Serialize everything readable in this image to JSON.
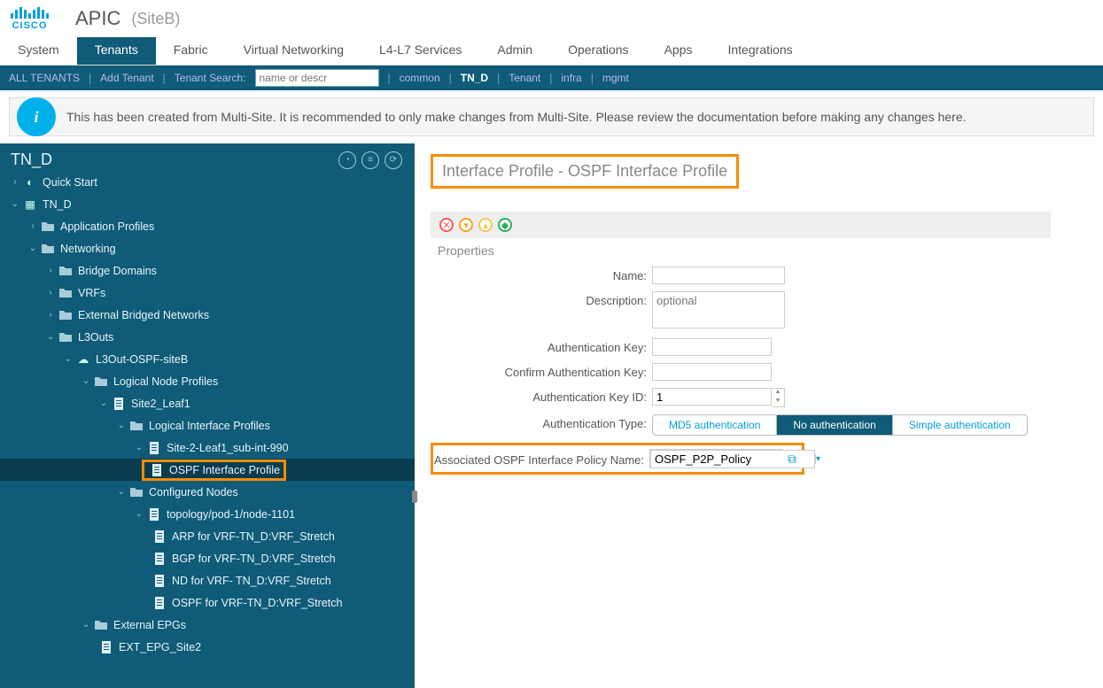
{
  "header": {
    "brand": "CISCO",
    "app": "APIC",
    "site": "(SiteB)"
  },
  "nav": {
    "items": [
      "System",
      "Tenants",
      "Fabric",
      "Virtual Networking",
      "L4-L7 Services",
      "Admin",
      "Operations",
      "Apps",
      "Integrations"
    ],
    "active_index": 1
  },
  "subnav": {
    "all_tenants": "ALL TENANTS",
    "add_tenant": "Add Tenant",
    "search_label": "Tenant Search:",
    "search_placeholder": "name or descr",
    "links": [
      "common",
      "TN_D",
      "Tenant",
      "infra",
      "mgmt"
    ],
    "bold_index": 1
  },
  "banner": {
    "message": "This has been created from Multi-Site. It is recommended to only make changes from Multi-Site. Please review the documentation before making any changes here."
  },
  "sidebar": {
    "title": "TN_D",
    "quick_start": "Quick Start",
    "tenant": "TN_D",
    "app_profiles": "Application Profiles",
    "networking": "Networking",
    "bridge_domains": "Bridge Domains",
    "vrfs": "VRFs",
    "ext_bridged": "External Bridged Networks",
    "l3outs": "L3Outs",
    "l3out_ospf": "L3Out-OSPF-siteB",
    "lnp": "Logical Node Profiles",
    "site2leaf1": "Site2_Leaf1",
    "lip": "Logical Interface Profiles",
    "subint": "Site-2-Leaf1_sub-int-990",
    "ospf_ip": "OSPF Interface Profile",
    "conf_nodes": "Configured Nodes",
    "topo_node": "topology/pod-1/node-1101",
    "arp": "ARP for VRF-TN_D:VRF_Stretch",
    "bgp": "BGP for VRF-TN_D:VRF_Stretch",
    "nd": "ND for VRF- TN_D:VRF_Stretch",
    "ospf": "OSPF for VRF-TN_D:VRF_Stretch",
    "ext_epgs": "External EPGs",
    "ext_epg_item": "EXT_EPG_Site2"
  },
  "main": {
    "title": "Interface Profile - OSPF Interface Profile",
    "properties_label": "Properties",
    "form": {
      "name_label": "Name:",
      "name_value": "",
      "desc_label": "Description:",
      "desc_placeholder": "optional",
      "authkey_label": "Authentication Key:",
      "confirm_authkey_label": "Confirm Authentication Key:",
      "authkeyid_label": "Authentication Key ID:",
      "authkeyid_value": "1",
      "authtype_label": "Authentication Type:",
      "authtype_options": [
        "MD5 authentication",
        "No authentication",
        "Simple authentication"
      ],
      "authtype_active": 1,
      "assoc_label": "Associated OSPF Interface Policy Name:",
      "assoc_value": "OSPF_P2P_Policy"
    }
  },
  "icons": {
    "info": "i"
  }
}
